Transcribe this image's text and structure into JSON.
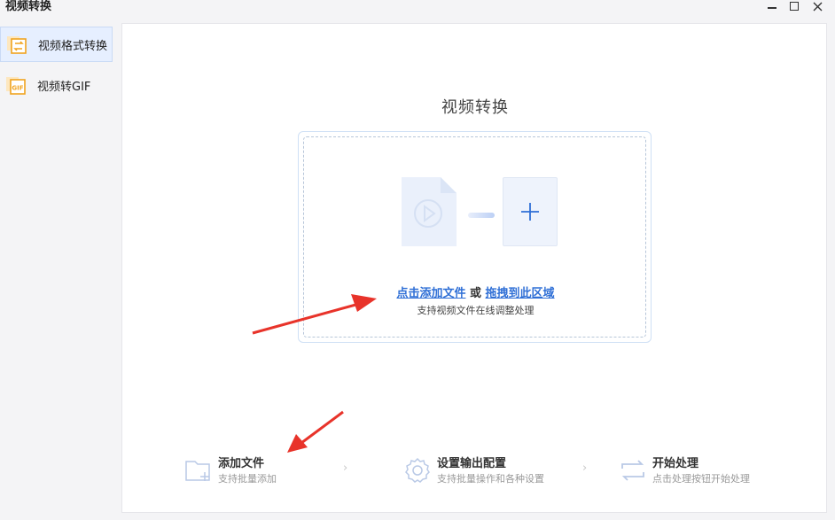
{
  "window": {
    "title": "视频转换",
    "controls": {
      "minimize": "minimize-icon",
      "maximize": "maximize-icon",
      "close": "close-icon"
    }
  },
  "sidebar": {
    "items": [
      {
        "label": "视频格式转换",
        "icon": "video-convert-icon",
        "active": true
      },
      {
        "label": "视频转GIF",
        "icon": "gif-icon",
        "active": false
      }
    ]
  },
  "main": {
    "title": "视频转换",
    "dropzone": {
      "click_link": "点击添加文件",
      "or_text": "或",
      "drag_link": "拖拽到此区域",
      "hint": "支持视频文件在线调整处理"
    },
    "steps": [
      {
        "title": "添加文件",
        "subtitle": "支持批量添加",
        "icon": "folder-add-icon"
      },
      {
        "title": "设置输出配置",
        "subtitle": "支持批量操作和各种设置",
        "icon": "gear-icon"
      },
      {
        "title": "开始处理",
        "subtitle": "点击处理按钮开始处理",
        "icon": "refresh-icon"
      }
    ]
  },
  "colors": {
    "accent": "#2f6fd6",
    "annotation": "#e8332a",
    "active_bg": "#e6efff",
    "icon_orange": "#f0a31f"
  }
}
